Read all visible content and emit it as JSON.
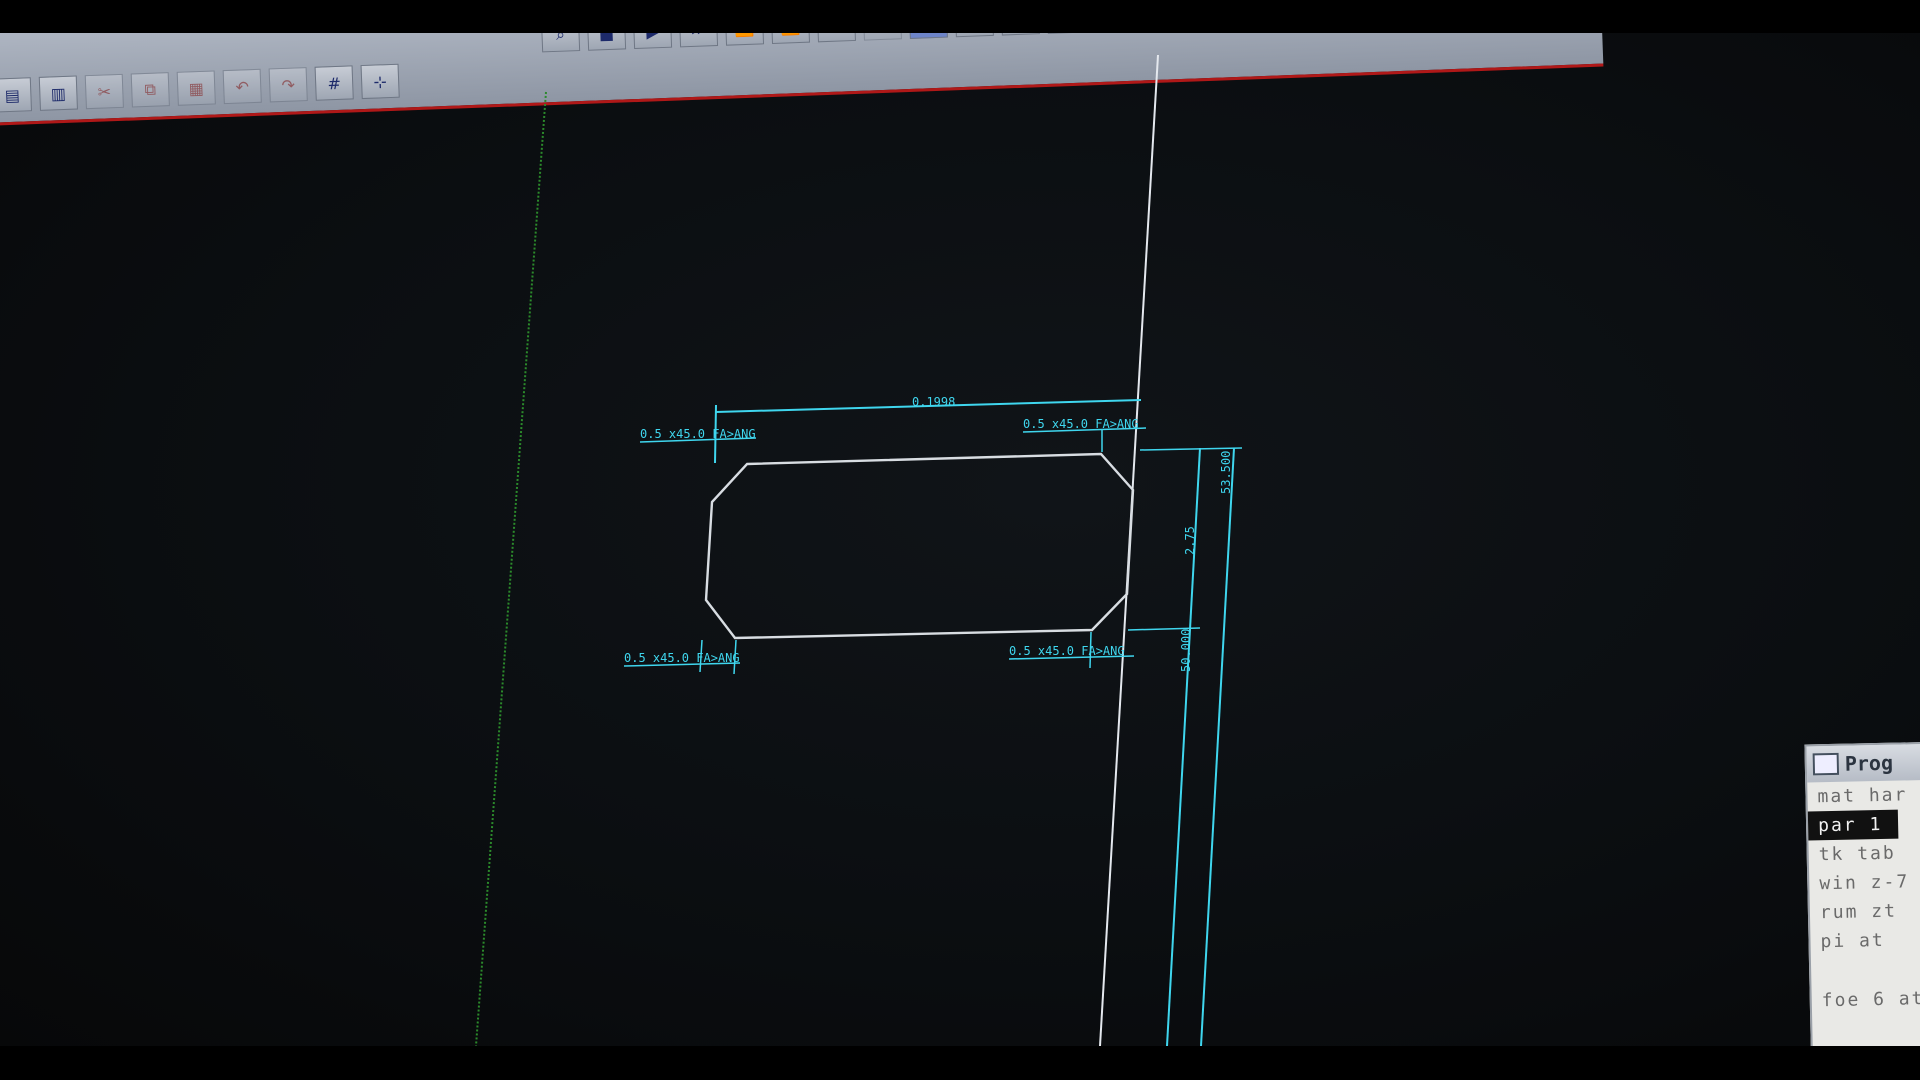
{
  "toolbar": {
    "row1": [
      "zoom",
      "stop",
      "play",
      "skip-end",
      "fast-forward",
      "rewind",
      "skip-start",
      "record",
      "layer",
      "warning",
      "dropdown",
      "blank",
      "select",
      "window"
    ],
    "row2": [
      "save",
      "open",
      "cut",
      "copy",
      "paste",
      "undo",
      "redo",
      "grid",
      "snap"
    ]
  },
  "drawing": {
    "dim_top_length": "0.1998",
    "chamfer_top_left": "0.5  x45.0 FA>ANG",
    "chamfer_top_right": "0.5  x45.0 FA>ANG",
    "chamfer_bottom_left": "0.5  x45.0 FA>ANG",
    "chamfer_bottom_right": "0.5  x45.0 FA>ANG",
    "dim_right_top": "53.500",
    "dim_right_mid": "2.75",
    "dim_right_bottom": "50.000"
  },
  "program_window": {
    "title": "Prog",
    "lines": [
      "mat har",
      "par 1",
      "tk tab",
      "win z-7",
      "rum zt",
      "pi at",
      "foe 6 at"
    ]
  },
  "colors": {
    "background": "#0b0e11",
    "profile_line": "#d8dde2",
    "dimension": "#3fd6ee",
    "axis_green": "#2b8a2b",
    "toolbar_bg": "#a9b0bc",
    "toolbar_border": "#b01818"
  }
}
